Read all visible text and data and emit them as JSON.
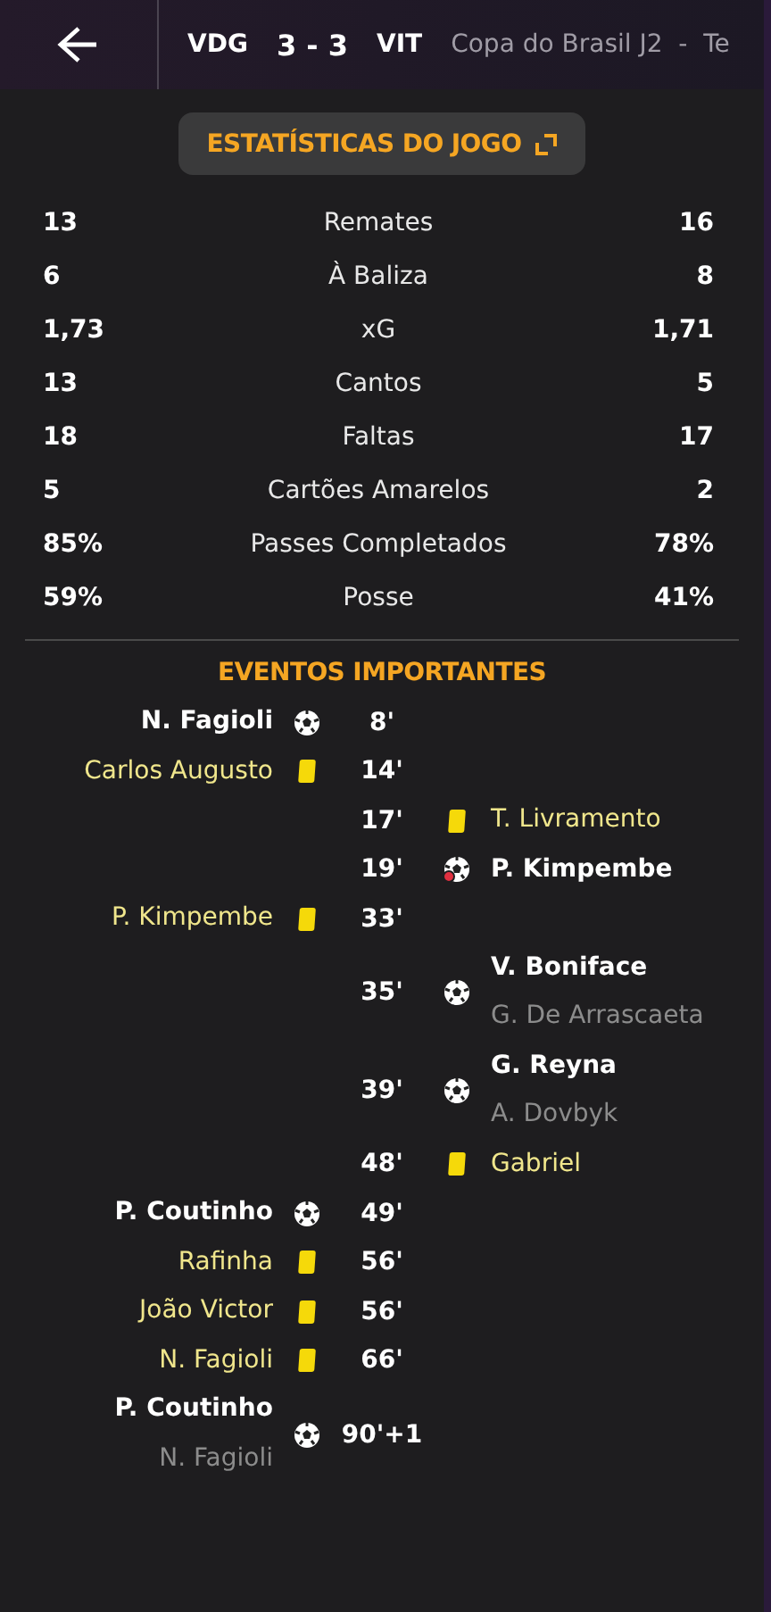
{
  "header": {
    "home": "VDG",
    "score": "3 - 3",
    "away": "VIT",
    "competition": "Copa do Brasil J2  -  Te"
  },
  "stats_button": {
    "label": "ESTATÍSTICAS DO JOGO"
  },
  "stats": [
    {
      "home": "13",
      "label": "Remates",
      "away": "16"
    },
    {
      "home": "6",
      "label": "À Baliza",
      "away": "8"
    },
    {
      "home": "1,73",
      "label": "xG",
      "away": "1,71"
    },
    {
      "home": "13",
      "label": "Cantos",
      "away": "5"
    },
    {
      "home": "18",
      "label": "Faltas",
      "away": "17"
    },
    {
      "home": "5",
      "label": "Cartões Amarelos",
      "away": "2"
    },
    {
      "home": "85%",
      "label": "Passes Completados",
      "away": "78%"
    },
    {
      "home": "59%",
      "label": "Posse",
      "away": "41%"
    }
  ],
  "events_title": "EVENTOS IMPORTANTES",
  "events": [
    {
      "kind": "goal",
      "home": {
        "player": "N. Fagioli"
      },
      "minute": "8'"
    },
    {
      "kind": "yellow",
      "home": {
        "player": "Carlos Augusto"
      },
      "minute": "14'"
    },
    {
      "kind": "yellow",
      "away": {
        "player": "T. Livramento"
      },
      "minute": "17'"
    },
    {
      "kind": "own_goal",
      "away": {
        "player": "P. Kimpembe"
      },
      "minute": "19'"
    },
    {
      "kind": "yellow",
      "home": {
        "player": "P. Kimpembe"
      },
      "minute": "33'"
    },
    {
      "kind": "goal",
      "away": {
        "player": "V. Boniface",
        "assist": "G. De Arrascaeta"
      },
      "minute": "35'"
    },
    {
      "kind": "goal",
      "away": {
        "player": "G. Reyna",
        "assist": "A. Dovbyk"
      },
      "minute": "39'"
    },
    {
      "kind": "yellow",
      "away": {
        "player": "Gabriel"
      },
      "minute": "48'"
    },
    {
      "kind": "goal",
      "home": {
        "player": "P. Coutinho"
      },
      "minute": "49'"
    },
    {
      "kind": "yellow",
      "home": {
        "player": "Rafinha"
      },
      "minute": "56'"
    },
    {
      "kind": "yellow",
      "home": {
        "player": "João Victor"
      },
      "minute": "56'"
    },
    {
      "kind": "yellow",
      "home": {
        "player": "N. Fagioli"
      },
      "minute": "66'"
    },
    {
      "kind": "goal",
      "home": {
        "player": "P. Coutinho",
        "assist": "N. Fagioli"
      },
      "minute": "90'+1"
    }
  ]
}
